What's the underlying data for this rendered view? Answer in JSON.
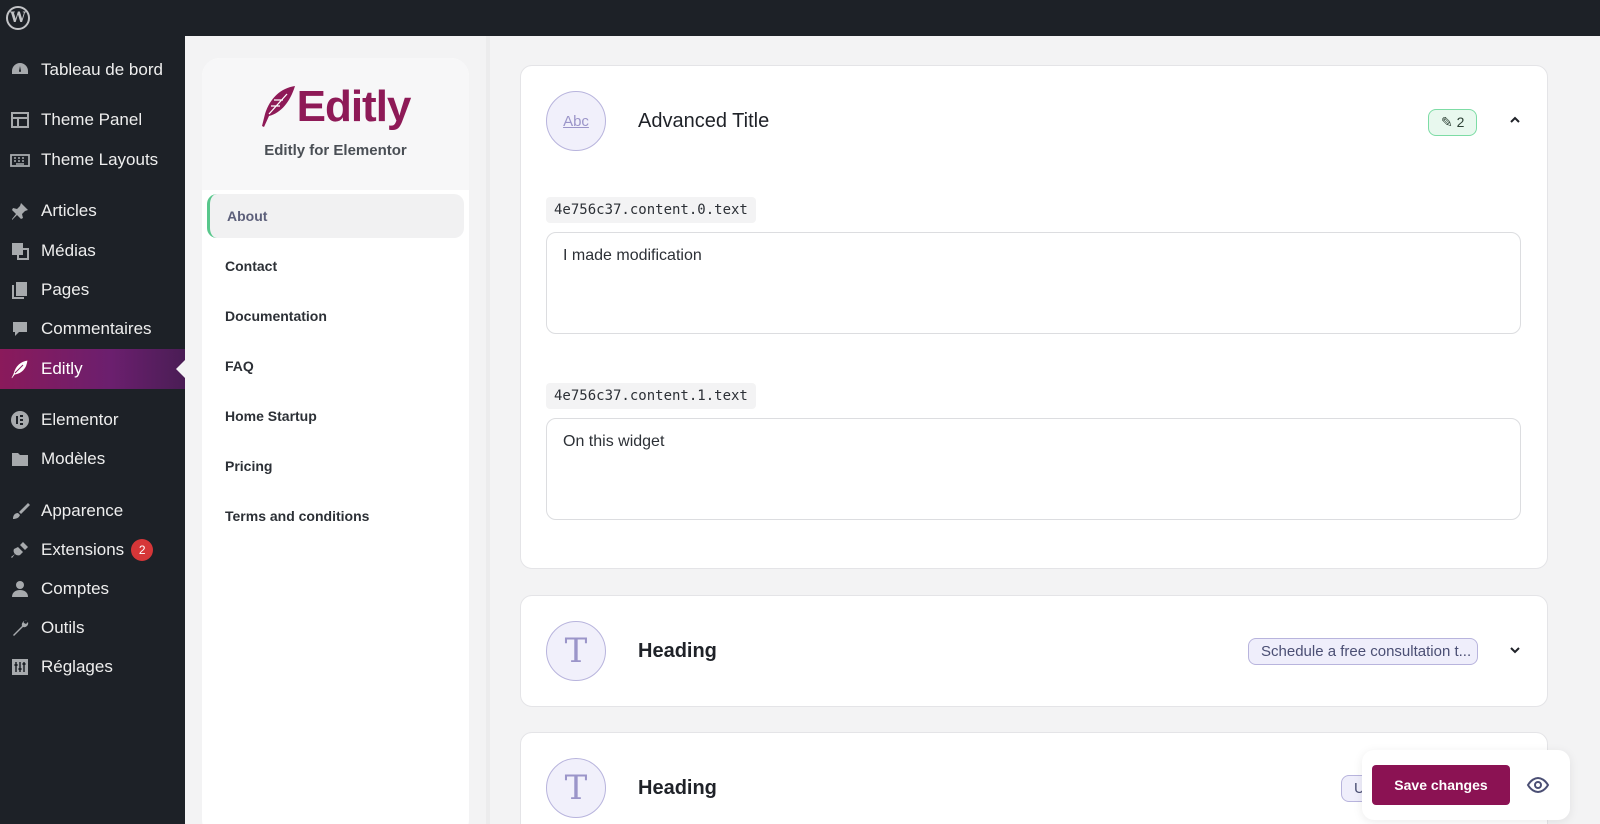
{
  "admin_menu": {
    "items": [
      {
        "label": "Tableau de bord",
        "icon": "dashboard-icon"
      },
      {
        "label": "Theme Panel",
        "icon": "theme-panel-icon"
      },
      {
        "label": "Theme Layouts",
        "icon": "keyboard-icon"
      },
      {
        "label": "Articles",
        "icon": "pin-icon"
      },
      {
        "label": "Médias",
        "icon": "media-icon"
      },
      {
        "label": "Pages",
        "icon": "pages-icon"
      },
      {
        "label": "Commentaires",
        "icon": "comment-icon"
      },
      {
        "label": "Editly",
        "icon": "feather-icon"
      },
      {
        "label": "Elementor",
        "icon": "elementor-icon"
      },
      {
        "label": "Modèles",
        "icon": "folder-icon"
      },
      {
        "label": "Apparence",
        "icon": "brush-icon"
      },
      {
        "label": "Extensions",
        "icon": "plugin-icon",
        "badge": "2"
      },
      {
        "label": "Comptes",
        "icon": "user-icon"
      },
      {
        "label": "Outils",
        "icon": "wrench-icon"
      },
      {
        "label": "Réglages",
        "icon": "settings-icon"
      }
    ],
    "active": "Editly"
  },
  "plugin": {
    "logo_text": "Editly",
    "subtitle": "Editly for Elementor",
    "nav": [
      "About",
      "Contact",
      "Documentation",
      "FAQ",
      "Home Startup",
      "Pricing",
      "Terms and conditions"
    ],
    "active_nav": "About"
  },
  "widgets": [
    {
      "title": "Advanced Title",
      "icon": "abc-icon",
      "icon_text": "Abc",
      "chip": "✎ 2",
      "expanded": true,
      "fields": [
        {
          "key": "4e756c37.content.0.text",
          "value": "I made modification"
        },
        {
          "key": "4e756c37.content.1.text",
          "value": "On this widget"
        }
      ]
    },
    {
      "title": "Heading",
      "icon": "text-t-icon",
      "icon_text": "T",
      "chip": "Schedule a free consultation t...",
      "expanded": false
    },
    {
      "title": "Heading",
      "icon": "text-t-icon",
      "icon_text": "T",
      "chip": "U",
      "expanded": false
    }
  ],
  "save": {
    "label": "Save changes"
  },
  "colors": {
    "brand": "#8b1253",
    "admin_bg": "#1d2127",
    "accent_green": "#58c78c"
  }
}
